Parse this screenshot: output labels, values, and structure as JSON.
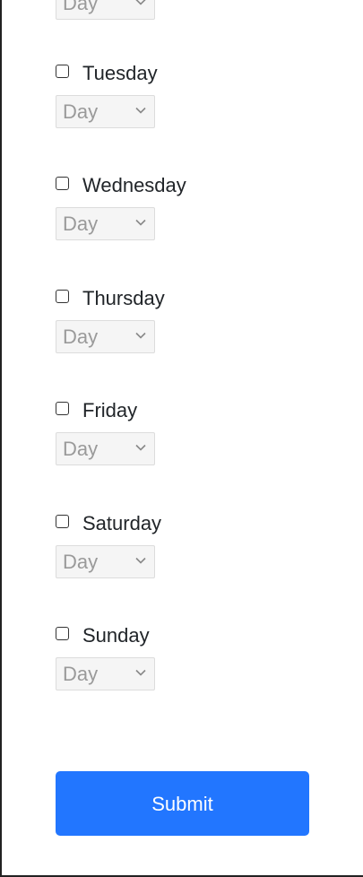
{
  "schedule": {
    "days": [
      {
        "label": "",
        "select_value": "Day"
      },
      {
        "label": "Tuesday",
        "select_value": "Day"
      },
      {
        "label": "Wednesday",
        "select_value": "Day"
      },
      {
        "label": "Thursday",
        "select_value": "Day"
      },
      {
        "label": "Friday",
        "select_value": "Day"
      },
      {
        "label": "Saturday",
        "select_value": "Day"
      },
      {
        "label": "Sunday",
        "select_value": "Day"
      }
    ]
  },
  "submit_label": "Submit",
  "colors": {
    "submit_bg": "#2276ff",
    "select_text": "#9a9a9a"
  }
}
